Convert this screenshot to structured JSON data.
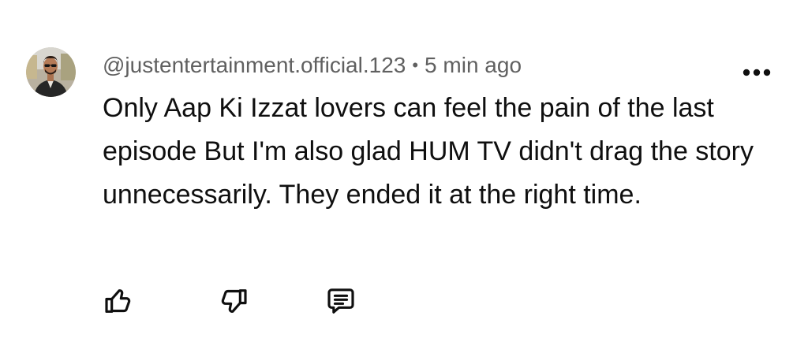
{
  "comment": {
    "author": "@justentertainment.official.123",
    "separator": "•",
    "time": "5 min ago",
    "text": "Only Aap Ki Izzat lovers can feel the pain of the last episode But I'm also glad HUM TV didn't drag the story unnecessarily. They ended it at the right time.",
    "avatar_icon": "user-avatar",
    "more_icon": "more-vert-icon"
  },
  "actions": {
    "like_icon": "thumbs-up-icon",
    "dislike_icon": "thumbs-down-icon",
    "reply_icon": "comment-reply-icon"
  },
  "colors": {
    "background": "#ffffff",
    "text": "#0f0f0f",
    "meta": "#606060"
  }
}
